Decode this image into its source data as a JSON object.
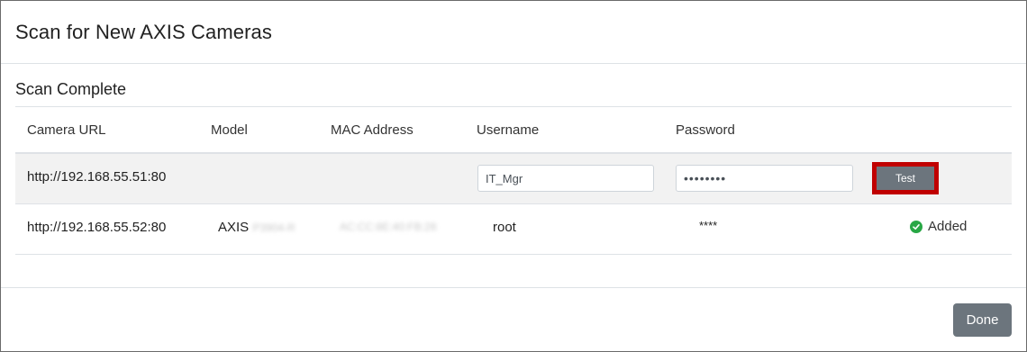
{
  "dialog": {
    "title": "Scan for New AXIS Cameras",
    "subtitle": "Scan Complete",
    "done_label": "Done"
  },
  "table": {
    "headers": {
      "url": "Camera URL",
      "model": "Model",
      "mac": "MAC Address",
      "username": "Username",
      "password": "Password"
    },
    "rows": [
      {
        "url": "http://192.168.55.51:80",
        "model": "",
        "mac": "",
        "username": "IT_Mgr",
        "password": "••••••••",
        "action_label": "Test"
      },
      {
        "url": "http://192.168.55.52:80",
        "model_prefix": "AXIS",
        "model_redacted": "P3904-R",
        "mac_redacted": "AC:CC:8E:40:FB:28",
        "username": "root",
        "password": "****",
        "status": "Added"
      }
    ]
  },
  "colors": {
    "button": "#6c757d",
    "highlight": "#c00000",
    "success": "#28a745",
    "stripe": "#f2f2f2"
  }
}
